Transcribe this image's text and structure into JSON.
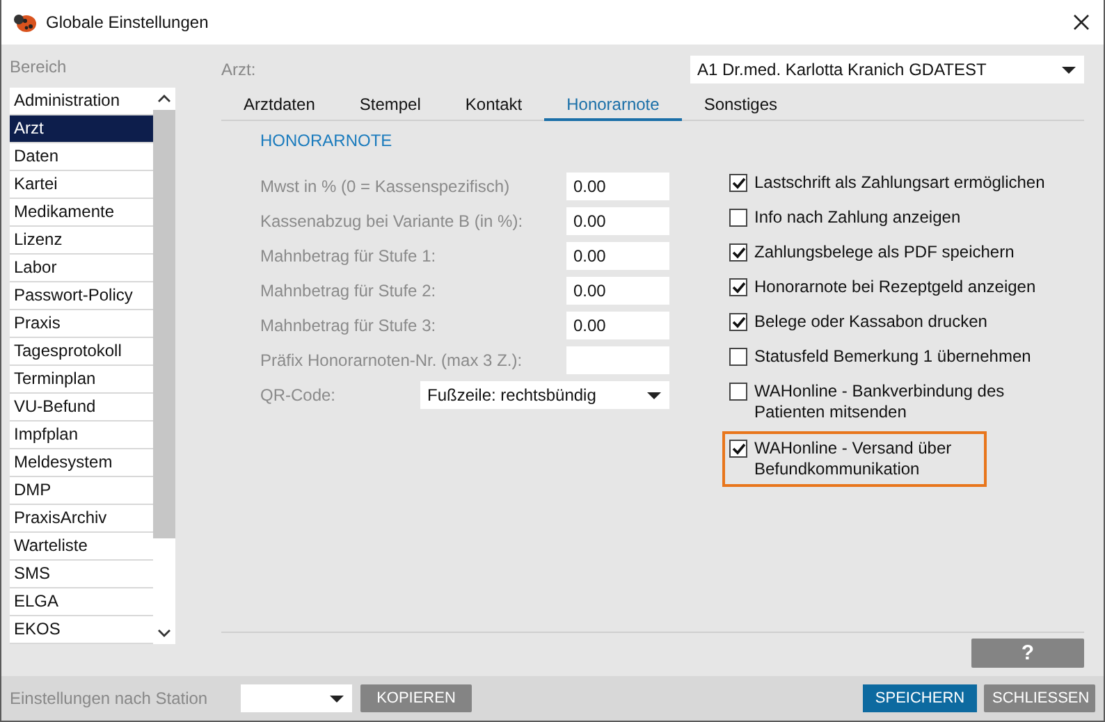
{
  "window": {
    "title": "Globale Einstellungen"
  },
  "sidebar": {
    "heading": "Bereich",
    "items": [
      {
        "label": "Administration",
        "selected": false
      },
      {
        "label": "Arzt",
        "selected": true
      },
      {
        "label": "Daten",
        "selected": false
      },
      {
        "label": "Kartei",
        "selected": false
      },
      {
        "label": "Medikamente",
        "selected": false
      },
      {
        "label": "Lizenz",
        "selected": false
      },
      {
        "label": "Labor",
        "selected": false
      },
      {
        "label": "Passwort-Policy",
        "selected": false
      },
      {
        "label": "Praxis",
        "selected": false
      },
      {
        "label": "Tagesprotokoll",
        "selected": false
      },
      {
        "label": "Terminplan",
        "selected": false
      },
      {
        "label": "VU-Befund",
        "selected": false
      },
      {
        "label": "Impfplan",
        "selected": false
      },
      {
        "label": "Meldesystem",
        "selected": false
      },
      {
        "label": "DMP",
        "selected": false
      },
      {
        "label": "PraxisArchiv",
        "selected": false
      },
      {
        "label": "Warteliste",
        "selected": false
      },
      {
        "label": "SMS",
        "selected": false
      },
      {
        "label": "ELGA",
        "selected": false
      },
      {
        "label": "EKOS",
        "selected": false
      }
    ]
  },
  "doctor": {
    "label": "Arzt:",
    "value": "A1 Dr.med. Karlotta Kranich GDATEST"
  },
  "tabs": [
    {
      "label": "Arztdaten",
      "selected": false
    },
    {
      "label": "Stempel",
      "selected": false
    },
    {
      "label": "Kontakt",
      "selected": false
    },
    {
      "label": "Honorarnote",
      "selected": true
    },
    {
      "label": "Sonstiges",
      "selected": false
    }
  ],
  "section_title": "HONORARNOTE",
  "fields": [
    {
      "kind": "input",
      "label": "Mwst in % (0 = Kassenspezifisch)",
      "value": "0.00"
    },
    {
      "kind": "input",
      "label": "Kassenabzug bei Variante B (in %):",
      "value": "0.00"
    },
    {
      "kind": "input",
      "label": "Mahnbetrag für Stufe 1:",
      "value": "0.00"
    },
    {
      "kind": "input",
      "label": "Mahnbetrag für Stufe 2:",
      "value": "0.00"
    },
    {
      "kind": "input",
      "label": "Mahnbetrag für Stufe 3:",
      "value": "0.00"
    },
    {
      "kind": "input",
      "label": "Präfix Honorarnoten-Nr. (max 3 Z.):"
    },
    {
      "kind": "select",
      "label": "QR-Code:",
      "value": "Fußzeile: rechtsbündig"
    }
  ],
  "options": [
    {
      "label": "Lastschrift als Zahlungsart ermöglichen",
      "checked": true,
      "highlighted": false
    },
    {
      "label": "Info nach Zahlung anzeigen",
      "checked": false,
      "highlighted": false
    },
    {
      "label": "Zahlungsbelege als PDF speichern",
      "checked": true,
      "highlighted": false
    },
    {
      "label": "Honorarnote bei Rezeptgeld anzeigen",
      "checked": true,
      "highlighted": false
    },
    {
      "label": "Belege oder Kassabon drucken",
      "checked": true,
      "highlighted": false
    },
    {
      "label": "Statusfeld Bemerkung 1 übernehmen",
      "checked": false,
      "highlighted": false
    },
    {
      "label": "WAHonline - Bankverbindung des Patienten mitsenden",
      "checked": false,
      "highlighted": false
    },
    {
      "label": "WAHonline - Versand über Befundkommunikation",
      "checked": true,
      "highlighted": true
    }
  ],
  "help_button": "?",
  "footer": {
    "label": "Einstellungen nach Station",
    "copy_button": "KOPIEREN",
    "save_button": "SPEICHERN",
    "close_button": "SCHLIESSEN"
  }
}
